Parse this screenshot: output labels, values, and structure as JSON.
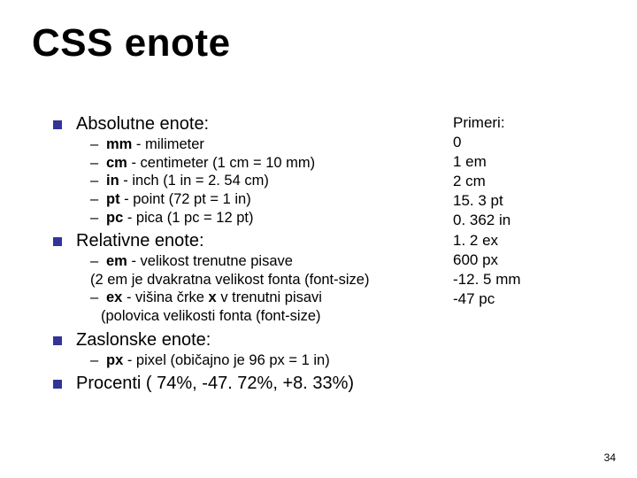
{
  "title": "CSS enote",
  "sections": {
    "absolute": {
      "heading": "Absolutne enote:",
      "items": [
        {
          "abbr": "mm",
          "desc": " - milimeter"
        },
        {
          "abbr": "cm",
          "desc": " - centimeter (1 cm = 10 mm)"
        },
        {
          "abbr": "in",
          "desc": " - inch (1 in = 2. 54 cm)"
        },
        {
          "abbr": "pt",
          "desc": " - point (72 pt = 1 in)"
        },
        {
          "abbr": "pc",
          "desc": " - pica (1 pc = 12 pt)"
        }
      ]
    },
    "relative": {
      "heading": "Relativne enote:",
      "items": [
        {
          "abbr": "em",
          "desc": " - velikost trenutne pisave",
          "cont": "(2 em je dvakratna velikost fonta (font-size)"
        },
        {
          "abbr": "ex",
          "desc_pre": " - višina črke ",
          "desc_bold": "x",
          "desc_post": " v trenutni pisavi",
          "cont": "(polovica velikosti fonta (font-size)"
        }
      ]
    },
    "screen": {
      "heading": "Zaslonske enote:",
      "items": [
        {
          "abbr": "px",
          "desc": " - pixel (običajno je 96 px = 1 in)"
        }
      ]
    },
    "percent": {
      "heading": "Procenti ( 74%, -47. 72%, +8. 33%)"
    }
  },
  "examples": {
    "heading": "Primeri:",
    "lines": [
      "0",
      "1 em",
      "2 cm",
      "15. 3 pt",
      "0. 362 in",
      "1. 2 ex",
      "600 px",
      "-12. 5 mm",
      "-47 pc"
    ]
  },
  "page": "34"
}
